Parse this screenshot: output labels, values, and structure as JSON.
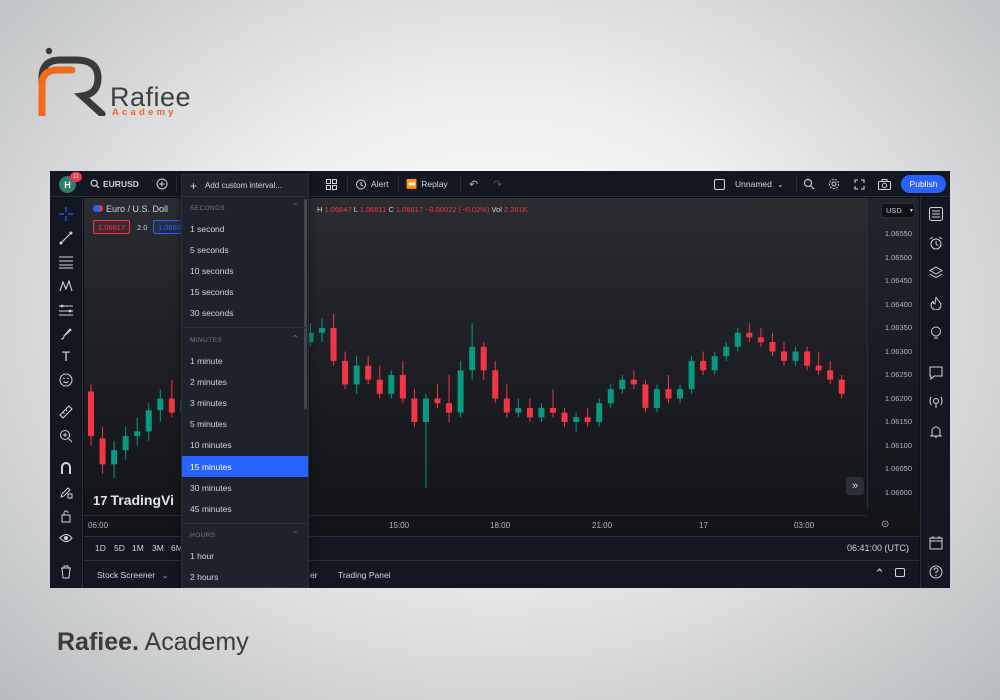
{
  "brand": {
    "name": "Rafiee",
    "sub": "Academy",
    "caption_bold": "Rafiee.",
    "caption_rest": " Academy"
  },
  "topbar": {
    "avatar": "H",
    "notifications": "11",
    "symbol": "EURUSD",
    "alert": "Alert",
    "replay": "Replay",
    "layout_name": "Unnamed",
    "publish": "Publish"
  },
  "intervals": {
    "add_custom": "Add custom interval...",
    "sections": [
      {
        "title": "SECONDS",
        "items": [
          "1 second",
          "5 seconds",
          "10 seconds",
          "15 seconds",
          "30 seconds"
        ]
      },
      {
        "title": "MINUTES",
        "items": [
          "1 minute",
          "2 minutes",
          "3 minutes",
          "5 minutes",
          "10 minutes",
          "15 minutes",
          "30 minutes",
          "45 minutes"
        ]
      },
      {
        "title": "HOURS",
        "items": [
          "1 hour",
          "2 hours"
        ]
      }
    ],
    "selected": "15 minutes"
  },
  "chart": {
    "title": "Euro / U.S. Doll",
    "ohlc": {
      "h_label": "H",
      "h": "1.06647",
      "l_label": "L",
      "l": "1.06611",
      "c_label": "C",
      "c": "1.06617",
      "chg": "−0.00022 (−0.02%)",
      "vol_label": "Vol",
      "vol": "2.261K"
    },
    "sell": "1.06617",
    "spread": "2.0",
    "buy": "1.0663",
    "currency": "USD",
    "watermark": "TradingVi",
    "price_ticks": [
      "1.06550",
      "1.06500",
      "1.06450",
      "1.06400",
      "1.06350",
      "1.06300",
      "1.06250",
      "1.06200",
      "1.06150",
      "1.06100",
      "1.06050",
      "1.06000"
    ],
    "time_ticks": [
      "06:00",
      "15:00",
      "18:00",
      "21:00",
      "17",
      "03:00"
    ],
    "colors": {
      "up": "#089981",
      "down": "#f23645",
      "accent": "#2962ff"
    }
  },
  "chart_data": {
    "type": "candlestick",
    "y_range": [
      1.0596,
      1.0658
    ],
    "series": [
      {
        "ohlc": [
          [
            1.06215,
            1.0623,
            1.061,
            1.0612
          ],
          [
            1.06115,
            1.0614,
            1.0604,
            1.0606
          ],
          [
            1.0606,
            1.0611,
            1.0603,
            1.0609
          ],
          [
            1.0609,
            1.0614,
            1.0607,
            1.0612
          ],
          [
            1.0612,
            1.0616,
            1.061,
            1.0613
          ],
          [
            1.0613,
            1.0619,
            1.0611,
            1.06175
          ],
          [
            1.06175,
            1.0622,
            1.0615,
            1.062
          ],
          [
            1.062,
            1.0624,
            1.0616,
            1.0617
          ],
          [
            1.0617,
            1.0621,
            1.0616,
            1.06195
          ],
          [
            1.06195,
            1.0626,
            1.0618,
            1.0624
          ],
          [
            1.0624,
            1.0652,
            1.0622,
            1.0648
          ],
          [
            1.0648,
            1.0654,
            1.0639,
            1.064
          ],
          [
            1.064,
            1.0646,
            1.0635,
            1.0638
          ],
          [
            1.0638,
            1.0641,
            1.0632,
            1.0634
          ],
          [
            1.0634,
            1.0638,
            1.0629,
            1.0631
          ],
          [
            1.0631,
            1.0639,
            1.063,
            1.0637
          ],
          [
            1.0637,
            1.064,
            1.0633,
            1.06345
          ],
          [
            1.06345,
            1.0646,
            1.0633,
            1.0641
          ],
          [
            1.0641,
            1.0645,
            1.063,
            1.0632
          ],
          [
            1.0632,
            1.0636,
            1.0631,
            1.0634
          ],
          [
            1.0634,
            1.0637,
            1.0632,
            1.0635
          ],
          [
            1.0635,
            1.0638,
            1.0627,
            1.0628
          ],
          [
            1.0628,
            1.063,
            1.0622,
            1.0623
          ],
          [
            1.0623,
            1.0629,
            1.0621,
            1.0627
          ],
          [
            1.0627,
            1.0629,
            1.0623,
            1.0624
          ],
          [
            1.0624,
            1.0627,
            1.062,
            1.0621
          ],
          [
            1.0621,
            1.0626,
            1.062,
            1.0625
          ],
          [
            1.0625,
            1.0628,
            1.0619,
            1.062
          ],
          [
            1.062,
            1.0622,
            1.0614,
            1.0615
          ],
          [
            1.0615,
            1.0621,
            1.0601,
            1.062
          ],
          [
            1.062,
            1.0623,
            1.0618,
            1.0619
          ],
          [
            1.0619,
            1.0625,
            1.0615,
            1.0617
          ],
          [
            1.0617,
            1.0628,
            1.0616,
            1.0626
          ],
          [
            1.0626,
            1.0636,
            1.0624,
            1.0631
          ],
          [
            1.0631,
            1.0632,
            1.0624,
            1.0626
          ],
          [
            1.0626,
            1.0628,
            1.0619,
            1.062
          ],
          [
            1.062,
            1.0623,
            1.0616,
            1.0617
          ],
          [
            1.0617,
            1.062,
            1.0616,
            1.0618
          ],
          [
            1.0618,
            1.062,
            1.0615,
            1.0616
          ],
          [
            1.0616,
            1.0619,
            1.0615,
            1.0618
          ],
          [
            1.0618,
            1.0622,
            1.0616,
            1.0617
          ],
          [
            1.0617,
            1.0618,
            1.0614,
            1.0615
          ],
          [
            1.0615,
            1.0617,
            1.0613,
            1.0616
          ],
          [
            1.0616,
            1.0618,
            1.0614,
            1.0615
          ],
          [
            1.0615,
            1.062,
            1.0614,
            1.0619
          ],
          [
            1.0619,
            1.0623,
            1.0618,
            1.0622
          ],
          [
            1.0622,
            1.0625,
            1.0621,
            1.0624
          ],
          [
            1.0624,
            1.0626,
            1.0622,
            1.0623
          ],
          [
            1.0623,
            1.0624,
            1.0617,
            1.0618
          ],
          [
            1.0618,
            1.0623,
            1.0617,
            1.0622
          ],
          [
            1.0622,
            1.0625,
            1.0619,
            1.062
          ],
          [
            1.062,
            1.0623,
            1.0619,
            1.0622
          ],
          [
            1.0622,
            1.0629,
            1.0621,
            1.0628
          ],
          [
            1.0628,
            1.063,
            1.0625,
            1.0626
          ],
          [
            1.0626,
            1.063,
            1.0625,
            1.0629
          ],
          [
            1.0629,
            1.0632,
            1.0628,
            1.0631
          ],
          [
            1.0631,
            1.0635,
            1.063,
            1.0634
          ],
          [
            1.0634,
            1.0636,
            1.0632,
            1.0633
          ],
          [
            1.0633,
            1.0635,
            1.0631,
            1.0632
          ],
          [
            1.0632,
            1.0634,
            1.0629,
            1.063
          ],
          [
            1.063,
            1.0632,
            1.0627,
            1.0628
          ],
          [
            1.0628,
            1.0631,
            1.0627,
            1.063
          ],
          [
            1.063,
            1.0631,
            1.0626,
            1.0627
          ],
          [
            1.0627,
            1.063,
            1.0625,
            1.0626
          ],
          [
            1.0626,
            1.0628,
            1.0623,
            1.0624
          ],
          [
            1.0624,
            1.0625,
            1.062,
            1.0621
          ]
        ]
      }
    ]
  },
  "rangebar": {
    "ranges": [
      "1D",
      "5D",
      "1M",
      "3M",
      "6M"
    ],
    "clock": "06:41:00 (UTC)"
  },
  "bottombar": {
    "screener": "Stock Screener",
    "editor_tail": "er",
    "trading_panel": "Trading Panel"
  }
}
